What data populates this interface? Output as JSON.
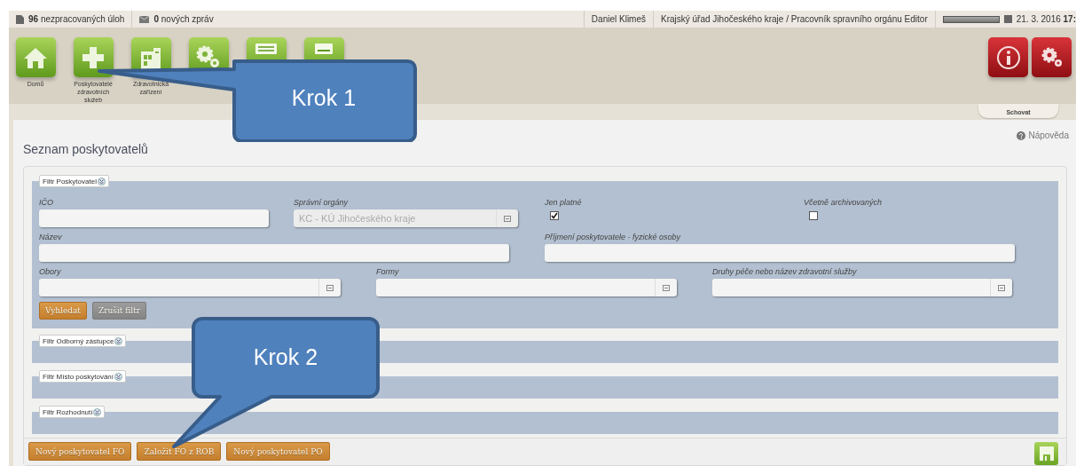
{
  "status_bar": {
    "tasks": {
      "count": "96",
      "label": "nezpracovaných úloh"
    },
    "messages": {
      "count": "0",
      "label": "nových zpráv"
    },
    "user": "Daniel Klimeš",
    "role": "Krajský úřad Jihočeského kraje / Pracovník spravního orgánu Editor",
    "date": "21. 3. 2016",
    "time": "17:"
  },
  "toolbar": {
    "tile_labels": [
      "Domů",
      "Poskytovatelé zdravotních služeb",
      "Zdravotnická zařízení"
    ]
  },
  "hide_tab": "Schovat",
  "page": {
    "title": "Seznam poskytovatelů",
    "help": "Nápověda"
  },
  "filters": [
    {
      "legend": "Filtr Poskytovatel",
      "expanded": true,
      "groups": [
        {
          "fields": [
            {
              "kind": "text",
              "label": "IČO"
            },
            {
              "kind": "lookup",
              "label": "Správní orgány",
              "value": "KC - KÚ Jihočeského kraje",
              "disabled": true
            },
            {
              "kind": "checkbox",
              "label": "Jen platné",
              "checked": true
            },
            {
              "kind": "checkbox",
              "label": "Včetně archivovaných",
              "checked": false
            }
          ]
        },
        {
          "fields": [
            {
              "kind": "text",
              "label": "Název"
            },
            {
              "kind": "text",
              "label": "Příjmení poskytovatele - fyzické osoby"
            }
          ]
        },
        {
          "fields": [
            {
              "kind": "lookup",
              "label": "Obory"
            },
            {
              "kind": "lookup",
              "label": "Formy"
            },
            {
              "kind": "lookup",
              "label": "Druhy péče nebo název zdravotní služby"
            }
          ]
        }
      ],
      "buttons": [
        {
          "label": "Vyhledat",
          "kind": "primary"
        },
        {
          "label": "Zrušit filtr",
          "kind": "secondary"
        }
      ]
    },
    {
      "legend": "Filtr Odborný zástupce",
      "expanded": false
    },
    {
      "legend": "Filtr Místo poskytování",
      "expanded": false
    },
    {
      "legend": "Filtr Rozhodnutí",
      "expanded": false
    }
  ],
  "actions": [
    {
      "label": "Nový poskytovatel FO",
      "kind": "primary"
    },
    {
      "label": "Založit FO z ROB",
      "kind": "primary"
    },
    {
      "label": "Nový poskytovatel PO",
      "kind": "primary"
    }
  ],
  "callouts": [
    {
      "label": "Krok 1"
    },
    {
      "label": "Krok 2"
    }
  ]
}
